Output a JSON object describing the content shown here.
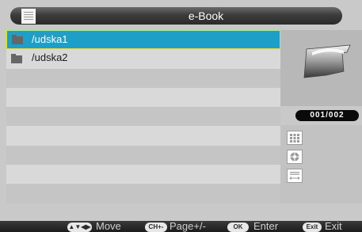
{
  "header": {
    "title": "e-Book",
    "menu_icon": "menu-icon"
  },
  "file_list": {
    "items": [
      {
        "label": "/udska1",
        "icon": "folder-icon",
        "selected": true
      },
      {
        "label": "/udska2",
        "icon": "folder-icon",
        "selected": false
      }
    ],
    "empty_rows": 8
  },
  "preview": {
    "icon": "book-icon",
    "counter": "001/002"
  },
  "tools": [
    {
      "icon": "thumbnail-grid-icon"
    },
    {
      "icon": "settings-wheel-icon"
    },
    {
      "icon": "page-width-icon"
    }
  ],
  "footer": {
    "hints": [
      {
        "key": "▲▼◀▶",
        "label": "Move"
      },
      {
        "key": "CH+-",
        "label": "Page+/-"
      },
      {
        "key": "OK",
        "label": "Enter"
      },
      {
        "key": "Exit",
        "label": "Exit"
      }
    ]
  },
  "colors": {
    "selection": "#1e9fc8",
    "selection_border": "#e5e500",
    "title_bar": "#2b2b2b"
  }
}
